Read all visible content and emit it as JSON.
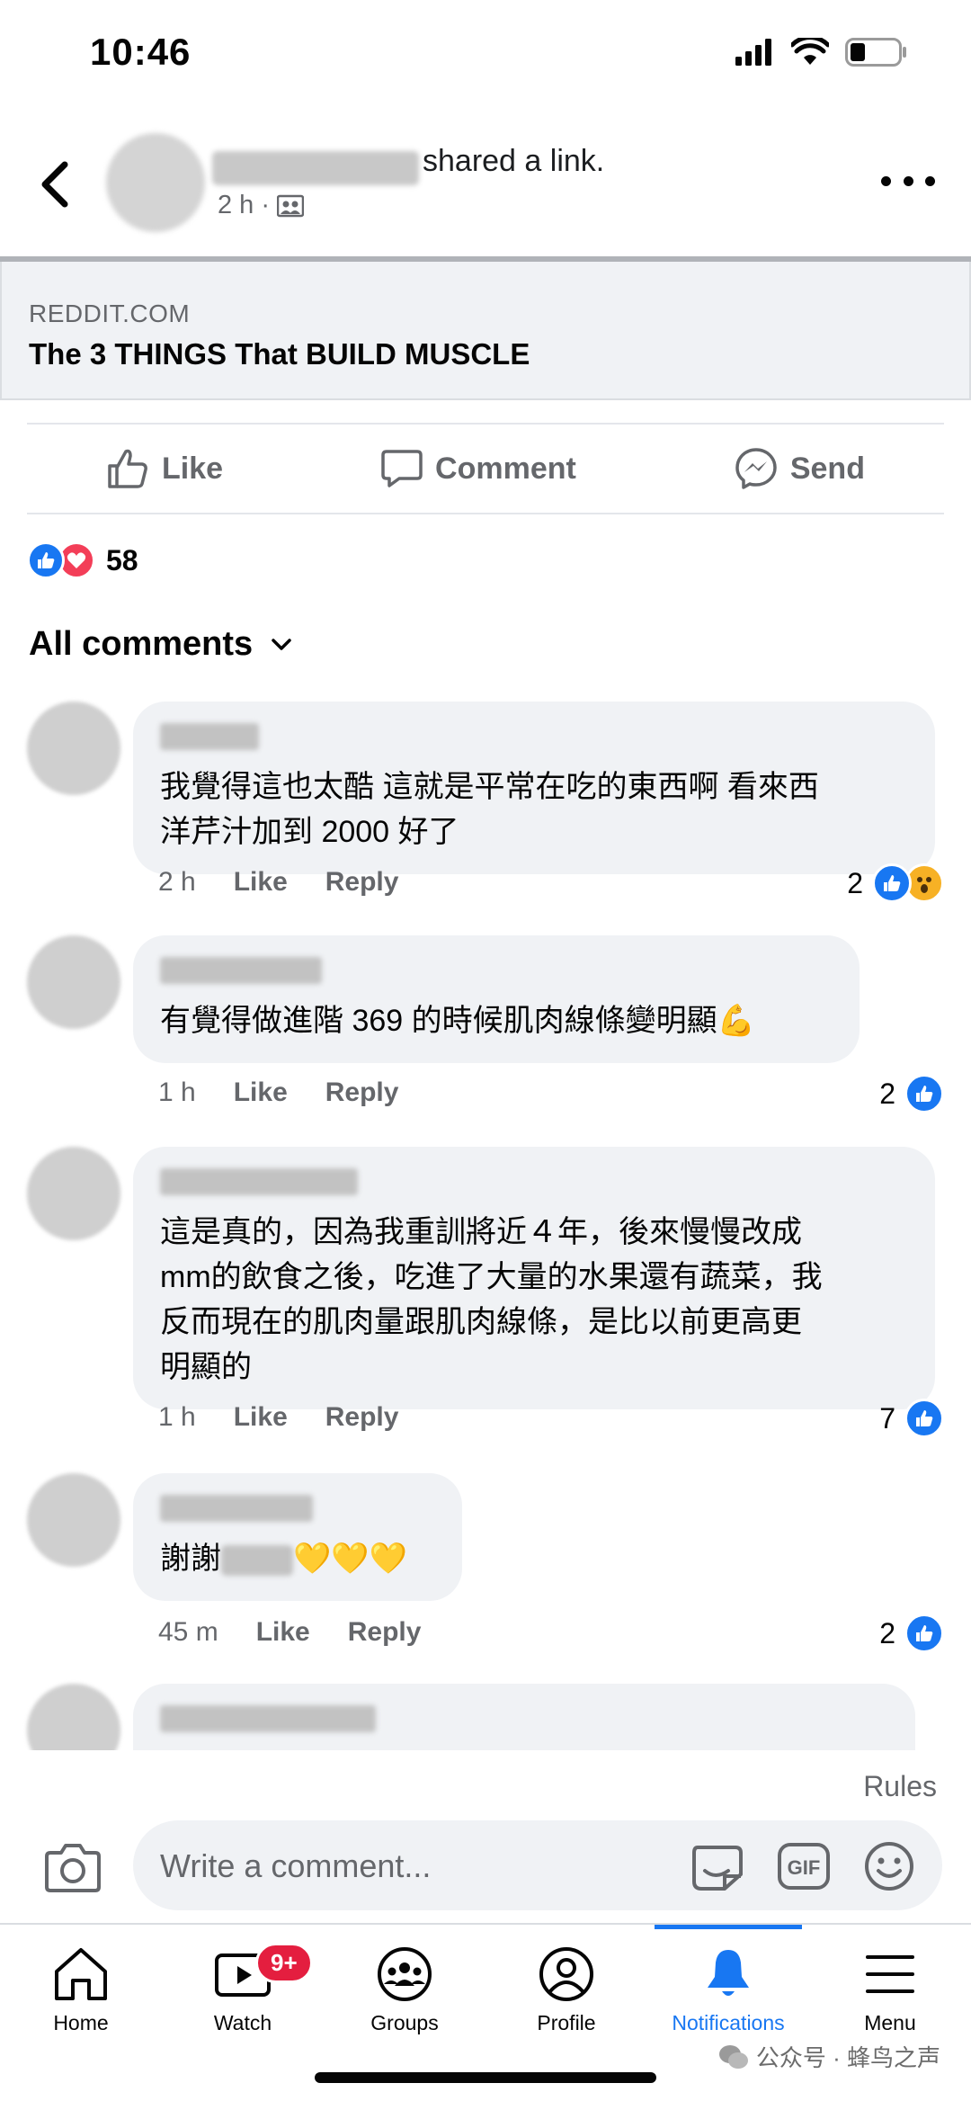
{
  "status_bar": {
    "time": "10:46"
  },
  "post": {
    "shared_text": "shared a link.",
    "time": "2 h ·"
  },
  "link_card": {
    "domain": "REDDIT.COM",
    "title": "The 3 THINGS That BUILD MUSCLE"
  },
  "actions": {
    "like": "Like",
    "comment": "Comment",
    "send": "Send"
  },
  "reactions": {
    "count": "58"
  },
  "comments_header": {
    "label": "All comments"
  },
  "comments": [
    {
      "text_line1": "我覺得這也太酷 這就是平常在吃的東西啊 看來西",
      "text_line2": "洋芹汁加到 2000 好了",
      "time": "2 h",
      "like": "Like",
      "reply": "Reply",
      "reaction_count": "2"
    },
    {
      "text": "有覺得做進階 369 的時候肌肉線條變明顯💪",
      "time": "1 h",
      "like": "Like",
      "reply": "Reply",
      "reaction_count": "2"
    },
    {
      "line1": "這是真的，因為我重訓將近４年，後來慢慢改成",
      "line2": "mm的飲食之後，吃進了大量的水果還有蔬菜，我",
      "line3": "反而現在的肌肉量跟肌肉線條，是比以前更高更",
      "line4": "明顯的",
      "time": "1 h",
      "like": "Like",
      "reply": "Reply",
      "reaction_count": "7"
    },
    {
      "text_prefix": "謝謝",
      "emoji": "💛💛💛",
      "time": "45 m",
      "like": "Like",
      "reply": "Reply",
      "reaction_count": "2"
    }
  ],
  "composer": {
    "rules": "Rules",
    "placeholder": "Write a comment..."
  },
  "nav": {
    "home": "Home",
    "watch": "Watch",
    "watch_badge": "9+",
    "groups": "Groups",
    "profile": "Profile",
    "notifications": "Notifications",
    "menu": "Menu"
  },
  "watermark": "公众号 · 蜂鸟之声",
  "colors": {
    "accent": "#1877f2",
    "badge": "#e41e3f",
    "love": "#f33e58",
    "bubble": "#f0f2f5"
  }
}
